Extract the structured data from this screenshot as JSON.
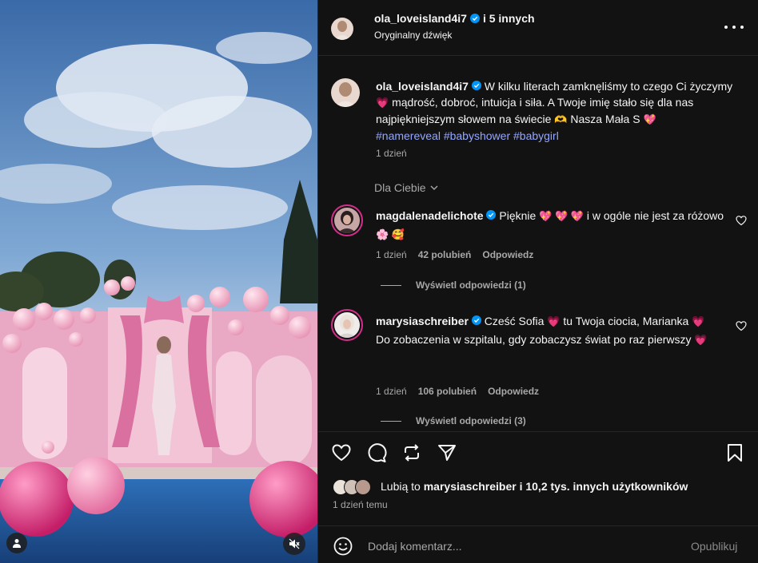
{
  "header": {
    "username": "ola_loveisland4i7",
    "others": "i 5 innych",
    "audio": "Oryginalny dźwięk"
  },
  "caption": {
    "username": "ola_loveisland4i7",
    "text_1": "W kilku literach zamknęliśmy to czego Ci życzymy",
    "heart_1": "💗",
    "text_2": "mądrość, dobroć, intuicja i siła. A Twoje imię stało się dla nas najpiękniejszym słowem na świecie",
    "emoji_2": "🫶",
    "text_3": "Nasza Mała S",
    "heart_3": "💖",
    "hashtags": [
      "#namereveal",
      "#babyshower",
      "#babygirl"
    ],
    "time": "1 dzień"
  },
  "section_label": "Dla Ciebie",
  "comments": [
    {
      "username": "magdalenadelichote",
      "text_a": "Pięknie",
      "emojis_a": "💖 💖 💖",
      "text_b": "i w ogóle nie jest za różowo",
      "emojis_b": "🌸 🥰",
      "time": "1 dzień",
      "likes": "42 polubień",
      "reply": "Odpowiedz",
      "view_replies": "Wyświetl odpowiedzi (1)"
    },
    {
      "username": "marysiaschreiber",
      "text_a": "Cześć Sofia",
      "emoji_a": "💗",
      "text_b": "tu Twoja ciocia, Marianka",
      "emoji_b": "💗",
      "text_c": "Do zobaczenia w szpitalu, gdy zobaczysz świat po raz pierwszy",
      "emoji_c": "💗",
      "time": "1 dzień",
      "likes": "106 polubień",
      "reply": "Odpowiedz",
      "view_replies": "Wyświetl odpowiedzi (3)"
    }
  ],
  "likes": {
    "prefix": "Lubią to",
    "user": "marysiaschreiber",
    "suffix": "i 10,2 tys. innych użytkowników"
  },
  "post_time": "1 dzień temu",
  "add_comment": {
    "placeholder": "Dodaj komentarz...",
    "post_label": "Opublikuj"
  },
  "icons": [
    "user-tag-icon",
    "mute-icon",
    "more-icon",
    "verified-icon",
    "heart-icon",
    "comment-icon",
    "repost-icon",
    "share-icon",
    "save-icon",
    "emoji-icon",
    "chevron-down-icon"
  ],
  "colors": {
    "background": "#121212",
    "hashtag": "#94a7ff",
    "verified": "#0095f6",
    "secondary_text": "#a8a8a8"
  }
}
